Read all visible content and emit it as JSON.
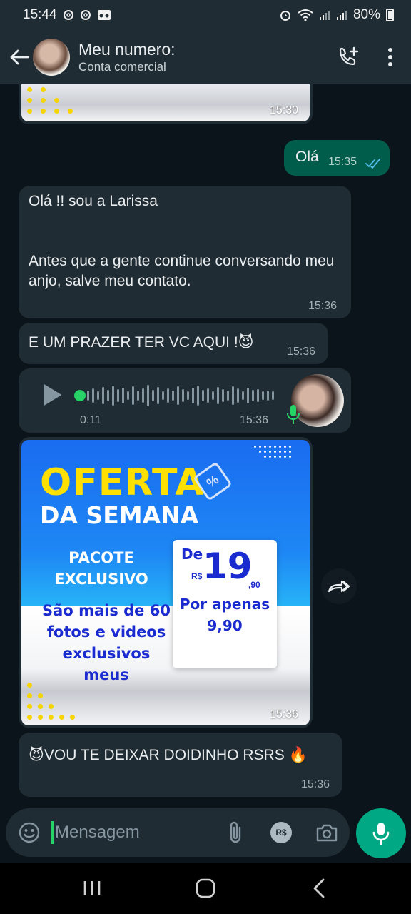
{
  "status_bar": {
    "time": "15:44",
    "battery": "80%",
    "icons": [
      "threads-icon",
      "threads-icon",
      "voicemail-icon",
      "alarm-icon",
      "wifi-icon",
      "signal-icon",
      "signal-icon",
      "battery-icon"
    ]
  },
  "header": {
    "contact_name": "Meu numero:",
    "contact_subtitle": "Conta comercial"
  },
  "messages": [
    {
      "type": "image",
      "direction": "in",
      "time": "15:30"
    },
    {
      "type": "text",
      "direction": "out",
      "text": "Olá",
      "time": "15:35",
      "status": "read"
    },
    {
      "type": "text",
      "direction": "in",
      "text": "Olá !! sou a Larissa\n\n\nAntes que a gente continue conversando meu anjo,  salve meu contato.",
      "time": "15:36"
    },
    {
      "type": "text",
      "direction": "in",
      "text": "E UM PRAZER TER VC AQUI !😈",
      "time": "15:36"
    },
    {
      "type": "voice",
      "direction": "in",
      "duration": "0:11",
      "time": "15:36"
    },
    {
      "type": "image",
      "direction": "in",
      "time": "15:36",
      "promo": {
        "title1": "OFERTA",
        "title2": "DA SEMANA",
        "package_line1": "PACOTE",
        "package_line2": "EXCLUSIVO",
        "desc_line1": "São mais de 60",
        "desc_line2": "fotos e videos",
        "desc_line3": "exclusivos",
        "desc_line4": "meus",
        "price_de": "De",
        "price_currency": "R$",
        "price_big": "19",
        "price_cents": ",90",
        "price_por": "Por apenas",
        "price_final": "9,90"
      }
    },
    {
      "type": "text",
      "direction": "in",
      "text": "😈VOU TE DEIXAR DOIDINHO RSRS 🔥",
      "time": "15:36"
    }
  ],
  "input": {
    "placeholder": "Mensagem"
  },
  "colors": {
    "bg": "#0b141a",
    "bar": "#1f2c34",
    "bubble_in": "#202c33",
    "bubble_out": "#005c4b",
    "accent": "#00a884",
    "read_ticks": "#53bdeb"
  }
}
